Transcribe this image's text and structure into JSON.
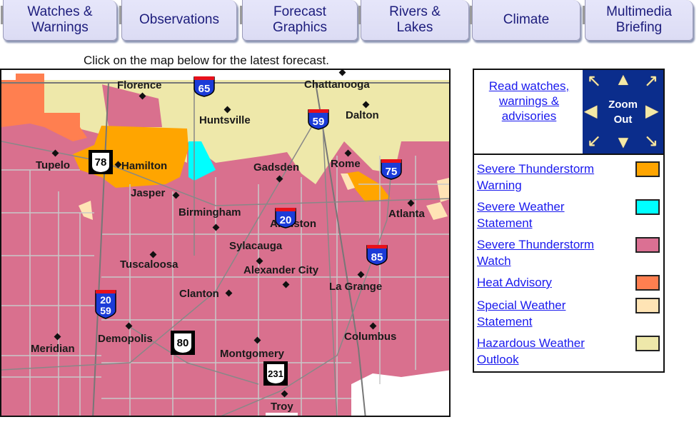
{
  "nav": {
    "tabs": [
      {
        "label": "Watches &\nWarnings"
      },
      {
        "label": "Observations"
      },
      {
        "label": "Forecast\nGraphics"
      },
      {
        "label": "Rivers &\nLakes"
      },
      {
        "label": "Climate"
      },
      {
        "label": "Multimedia\nBriefing"
      }
    ]
  },
  "map": {
    "instruction": "Click on the map below for the latest forecast.",
    "cities": [
      {
        "name": "Florence"
      },
      {
        "name": "Huntsville"
      },
      {
        "name": "Chattanooga"
      },
      {
        "name": "Dalton"
      },
      {
        "name": "Tupelo"
      },
      {
        "name": "Hamilton"
      },
      {
        "name": "Gadsden"
      },
      {
        "name": "Rome"
      },
      {
        "name": "Jasper"
      },
      {
        "name": "Birmingham"
      },
      {
        "name": "Anniston"
      },
      {
        "name": "Atlanta"
      },
      {
        "name": "Sylacauga"
      },
      {
        "name": "Tuscaloosa"
      },
      {
        "name": "Alexander City"
      },
      {
        "name": "La Grange"
      },
      {
        "name": "Clanton"
      },
      {
        "name": "Demopolis"
      },
      {
        "name": "Meridian"
      },
      {
        "name": "Columbus"
      },
      {
        "name": "Montgomery"
      },
      {
        "name": "Troy"
      }
    ],
    "interstates": [
      {
        "number": "65"
      },
      {
        "number": "59"
      },
      {
        "number": "75"
      },
      {
        "number": "20"
      },
      {
        "number": "85"
      },
      {
        "number": "20\n59"
      }
    ],
    "us_routes": [
      {
        "number": "78"
      },
      {
        "number": "80"
      },
      {
        "number": "231"
      }
    ]
  },
  "panel": {
    "read_link": "Read watches, warnings & advisories",
    "zoom_label": "Zoom\nOut",
    "legend": [
      {
        "label": "Severe Thunderstorm Warning",
        "color": "#ffa500"
      },
      {
        "label": "Severe Weather Statement",
        "color": "#00ffff"
      },
      {
        "label": "Severe Thunderstorm Watch",
        "color": "#db7093"
      },
      {
        "label": "Heat Advisory",
        "color": "#ff7f50"
      },
      {
        "label": "Special Weather Statement",
        "color": "#ffe4b5"
      },
      {
        "label": "Hazardous Weather Outlook",
        "color": "#eee8aa"
      }
    ]
  }
}
